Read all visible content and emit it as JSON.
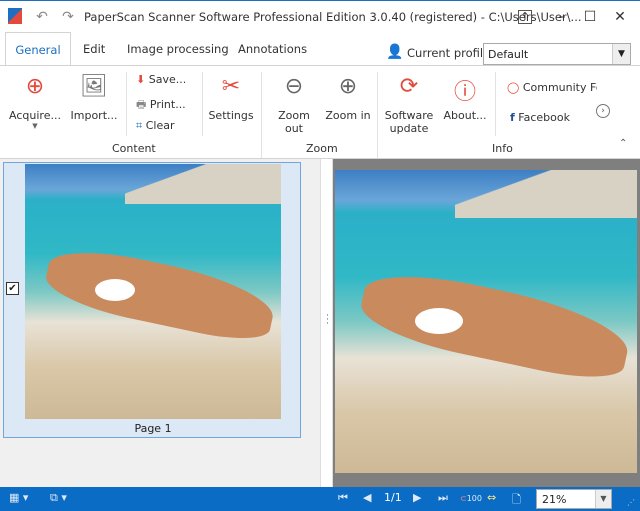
{
  "title": "PaperScan Scanner Software Professional Edition 3.0.40 (registered) - C:\\Users\\User\\...",
  "tabs": [
    "General",
    "Edit",
    "Image processing",
    "Annotations"
  ],
  "profile": {
    "label": "Current profile:",
    "value": "Default"
  },
  "ribbon": {
    "acquire": "Acquire...",
    "import": "Import...",
    "save": "Save...",
    "print": "Print...",
    "clear": "Clear",
    "settings": "Settings",
    "zoom_out": "Zoom out",
    "zoom_in": "Zoom in",
    "software_update_1": "Software",
    "software_update_2": "update",
    "about": "About...",
    "community": "Community For",
    "facebook": "Facebook",
    "groups": {
      "content": "Content",
      "zoom": "Zoom",
      "info": "Info"
    }
  },
  "thumbnail": {
    "label": "Page 1",
    "checked": true
  },
  "status": {
    "page": "1/1",
    "zoom": "21%",
    "fit_label": "100"
  },
  "colors": {
    "accent": "#1e6fc0",
    "status_bar": "#0a6cc4",
    "icon_red": "#e34a3c"
  }
}
